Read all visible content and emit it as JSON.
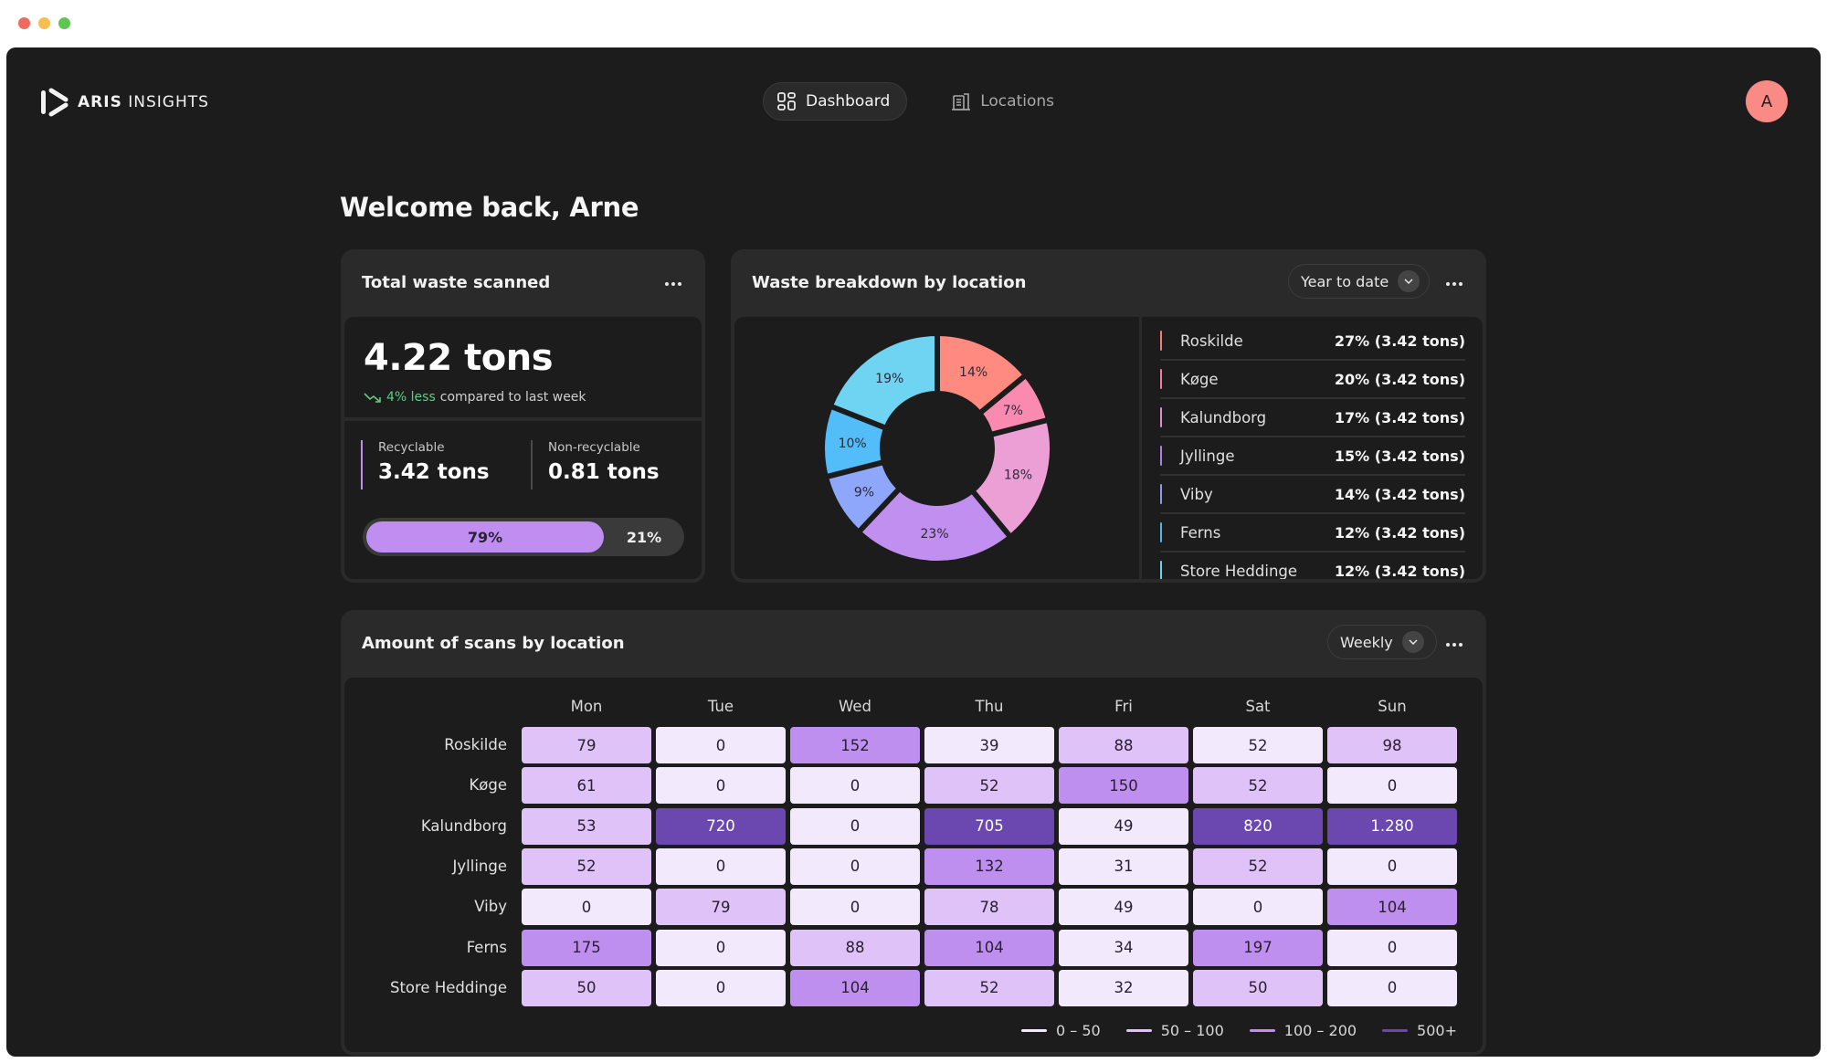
{
  "window": {
    "traffic_lights": [
      "close",
      "minimize",
      "zoom"
    ]
  },
  "header": {
    "logo": {
      "bold": "ARIS",
      "light": "INSIGHTS",
      "icon": "play-bracket-logo"
    },
    "nav": [
      {
        "label": "Dashboard",
        "icon": "grid-icon",
        "active": true
      },
      {
        "label": "Locations",
        "icon": "building-icon",
        "active": false
      }
    ],
    "avatar_initial": "A",
    "avatar_color": "#f98a86"
  },
  "welcome": "Welcome back, Arne",
  "total_waste": {
    "title": "Total waste scanned",
    "value": "4.22 tons",
    "trend_icon": "trending-down-icon",
    "trend_change": "4% less",
    "trend_rest": "compared to last week",
    "recyclable": {
      "label": "Recyclable",
      "value": "3.42 tons",
      "color": "#bf8ef0"
    },
    "non_recyclable": {
      "label": "Non-recyclable",
      "value": "0.81 tons",
      "color": "#4a4a4a"
    },
    "split": {
      "recyclable_pct": 79,
      "non_recyclable_pct": 21,
      "recyclable_label": "79%",
      "non_recyclable_label": "21%"
    }
  },
  "breakdown": {
    "title": "Waste breakdown by location",
    "period": "Year to date",
    "legend": [
      {
        "name": "Roskilde",
        "value": "27% (3.42 tons)",
        "color": "#f07e7a"
      },
      {
        "name": "Køge",
        "value": "20% (3.42 tons)",
        "color": "#ee7fa3"
      },
      {
        "name": "Kalundborg",
        "value": "17% (3.42 tons)",
        "color": "#dd8ecb"
      },
      {
        "name": "Jyllinge",
        "value": "15% (3.42 tons)",
        "color": "#a884e0"
      },
      {
        "name": "Viby",
        "value": "14% (3.42 tons)",
        "color": "#8d9bea"
      },
      {
        "name": "Ferns",
        "value": "12% (3.42 tons)",
        "color": "#4fb6ec"
      },
      {
        "name": "Store Heddinge",
        "value": "12% (3.42 tons)",
        "color": "#6ad2ee"
      }
    ]
  },
  "scans": {
    "title": "Amount of scans by location",
    "period": "Weekly",
    "legend": [
      {
        "label": "0 – 50",
        "color": "#f3e9fc"
      },
      {
        "label": "50 – 100",
        "color": "#dfc2f8"
      },
      {
        "label": "100 – 200",
        "color": "#bf8ff0"
      },
      {
        "label": "500+",
        "color": "#6b48b0"
      }
    ]
  },
  "chart_data": [
    {
      "type": "pie",
      "title": "Waste breakdown by location",
      "donut": true,
      "slices": [
        {
          "label": "14%",
          "value": 14,
          "color": "#ff8a80"
        },
        {
          "label": "7%",
          "value": 7,
          "color": "#fb8ab0"
        },
        {
          "label": "18%",
          "value": 18,
          "color": "#ec9fd4"
        },
        {
          "label": "23%",
          "value": 23,
          "color": "#c08ff0"
        },
        {
          "label": "9%",
          "value": 9,
          "color": "#8fa7fb"
        },
        {
          "label": "10%",
          "value": 10,
          "color": "#52bdf8"
        },
        {
          "label": "19%",
          "value": 19,
          "color": "#6fd3f2"
        }
      ]
    },
    {
      "type": "heatmap",
      "title": "Amount of scans by location",
      "columns": [
        "Mon",
        "Tue",
        "Wed",
        "Thu",
        "Fri",
        "Sat",
        "Sun"
      ],
      "rows": [
        "Roskilde",
        "Køge",
        "Kalundborg",
        "Jyllinge",
        "Viby",
        "Ferns",
        "Store Heddinge"
      ],
      "values": [
        [
          "79",
          "0",
          "152",
          "39",
          "88",
          "52",
          "98"
        ],
        [
          "61",
          "0",
          "0",
          "52",
          "150",
          "52",
          "0"
        ],
        [
          "53",
          "720",
          "0",
          "705",
          "49",
          "820",
          "1.280"
        ],
        [
          "52",
          "0",
          "0",
          "132",
          "31",
          "52",
          "0"
        ],
        [
          "0",
          "79",
          "0",
          "78",
          "49",
          "0",
          "104"
        ],
        [
          "175",
          "0",
          "88",
          "104",
          "34",
          "197",
          "0"
        ],
        [
          "50",
          "0",
          "104",
          "52",
          "32",
          "50",
          "0"
        ]
      ],
      "levels": [
        [
          1,
          0,
          2,
          0,
          1,
          0,
          1
        ],
        [
          1,
          0,
          0,
          1,
          2,
          1,
          0
        ],
        [
          1,
          3,
          0,
          3,
          0,
          3,
          3
        ],
        [
          1,
          0,
          0,
          2,
          0,
          1,
          0
        ],
        [
          0,
          1,
          0,
          1,
          0,
          0,
          2
        ],
        [
          2,
          0,
          1,
          2,
          0,
          2,
          0
        ],
        [
          1,
          0,
          2,
          1,
          0,
          1,
          0
        ]
      ],
      "legend": [
        "0 – 50",
        "50 – 100",
        "100 – 200",
        "500+"
      ]
    }
  ]
}
